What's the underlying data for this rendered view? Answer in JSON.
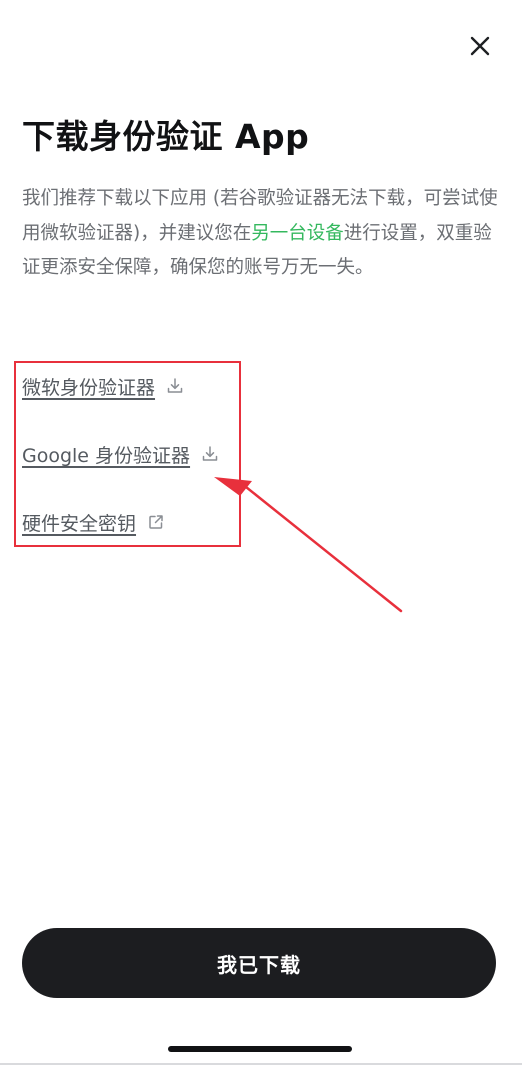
{
  "header": {
    "close_icon": "close-icon",
    "title": "下载身份验证 App"
  },
  "description": {
    "part1": "我们推荐下载以下应用 (若谷歌验证器无法下载，可尝试使用微软验证器)，并建议您在",
    "highlight": "另一台设备",
    "part2": "进行设置，双重验证更添安全保障，确保您的账号万无一失。"
  },
  "links": [
    {
      "label": "微软身份验证器",
      "icon": "download-icon"
    },
    {
      "label": "Google 身份验证器",
      "icon": "download-icon"
    },
    {
      "label": "硬件安全密钥",
      "icon": "external-link-icon"
    }
  ],
  "footer": {
    "primary_button": "我已下载"
  },
  "colors": {
    "accent_green": "#34b85e",
    "button_bg": "#1c1d20",
    "annotation_red": "#e8303c"
  }
}
